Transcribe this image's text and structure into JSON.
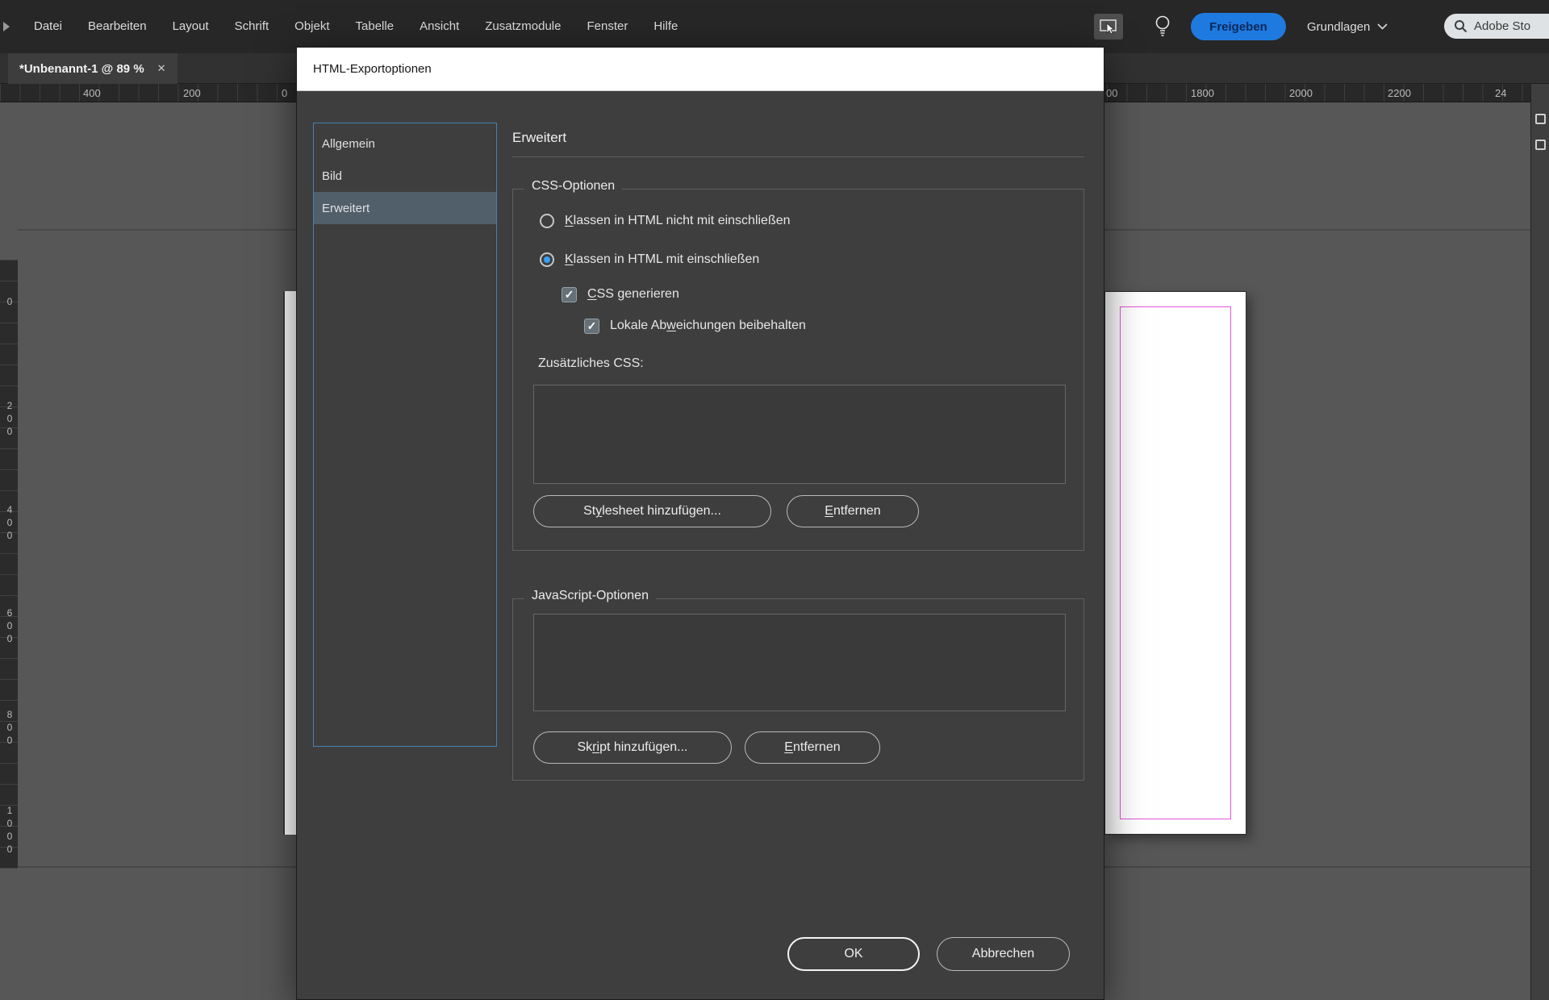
{
  "icons": {
    "check": "✓",
    "close": "✕"
  },
  "menubar": {
    "items": [
      "Datei",
      "Bearbeiten",
      "Layout",
      "Schrift",
      "Objekt",
      "Tabelle",
      "Ansicht",
      "Zusatzmodule",
      "Fenster",
      "Hilfe"
    ],
    "share_button": "Freigeben",
    "workspace": "Grundlagen",
    "search_text": "Adobe Sto"
  },
  "tabbar": {
    "title": "*Unbenannt-1 @ 89 %"
  },
  "rulers": {
    "h": [
      "400",
      "200",
      "0",
      "00",
      "1800",
      "2000",
      "2200",
      "24"
    ],
    "v": [
      "0",
      "200",
      "400",
      "600",
      "800",
      "1000"
    ]
  },
  "dialog": {
    "title": "HTML-Exportoptionen",
    "sidebar": [
      "Allgemein",
      "Bild",
      "Erweitert"
    ],
    "panel_heading": "Erweitert",
    "css": {
      "legend": "CSS-Optionen",
      "radio_exclude": {
        "pre": "",
        "key": "K",
        "post": "lassen in HTML nicht mit einschließen"
      },
      "radio_include": {
        "pre": "",
        "key": "K",
        "post": "lassen in HTML mit einschließen"
      },
      "check_generate": {
        "pre": "",
        "key": "C",
        "post": "SS generieren"
      },
      "check_overrides": {
        "pre": "Lokale Ab",
        "key": "w",
        "post": "eichungen beibehalten"
      },
      "additional_label": "Zusätzliches CSS:",
      "add": {
        "pre": "St",
        "key": "y",
        "post": "lesheet hinzufügen..."
      },
      "remove": {
        "pre": "",
        "key": "E",
        "post": "ntfernen"
      }
    },
    "js": {
      "legend": "JavaScript-Optionen",
      "add": {
        "pre": "Sk",
        "key": "ri",
        "post": "pt hinzufügen..."
      },
      "remove": {
        "pre": "",
        "key": "E",
        "post": "ntfernen"
      }
    },
    "ok": "OK",
    "cancel": "Abbrechen"
  }
}
